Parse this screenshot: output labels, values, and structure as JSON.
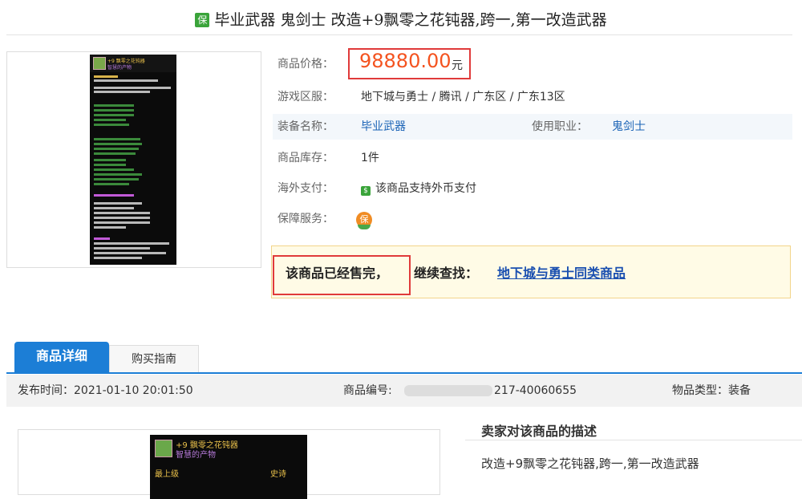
{
  "title": {
    "badge": "保",
    "text": "毕业武器 鬼剑士 改造+9飘零之花钝器,跨一,第一改造武器"
  },
  "thumbnail": {
    "name_line": "+9 飘零之花钝器",
    "sub_line": "智慧的产物"
  },
  "product": {
    "price_label": "商品价格：",
    "price_value": "98880.00",
    "price_unit": "元",
    "region_label": "游戏区服：",
    "region_value": "地下城与勇士 / 腾讯 / 广东区 / 广东13区",
    "equip_label": "装备名称：",
    "equip_value": "毕业武器",
    "class_label": "使用职业：",
    "class_value": "鬼剑士",
    "stock_label": "商品库存：",
    "stock_value": "1件",
    "overseas_label": "海外支付：",
    "overseas_icon": "money-icon",
    "overseas_value": "该商品支持外币支付",
    "guarantee_label": "保障服务：",
    "guarantee_icon": "shield-icon"
  },
  "soldout": {
    "status": "该商品已经售完，",
    "continue_label": "继续查找：",
    "continue_link": "地下城与勇士同类商品"
  },
  "tabs": [
    {
      "label": "商品详细",
      "active": true
    },
    {
      "label": "购买指南",
      "active": false
    }
  ],
  "meta": {
    "publish_label": "发布时间：",
    "publish_value": "2021-01-10 20:01:50",
    "code_label": "商品编号:",
    "code_value": "217-40060655",
    "type_label": "物品类型：",
    "type_value": "装备"
  },
  "preview_card": {
    "name_line": "+9 飘零之花钝器",
    "sub_line": "智慧的产物",
    "grade_line": "最上级",
    "rarity": "史诗"
  },
  "description": {
    "title": "卖家对该商品的描述",
    "text": "改造+9飘零之花钝器,跨一,第一改造武器"
  },
  "colors": {
    "price": "#f4531f",
    "link": "#1a63b6",
    "highlight_border": "#e03a3a",
    "tab": "#1c7ed6"
  }
}
